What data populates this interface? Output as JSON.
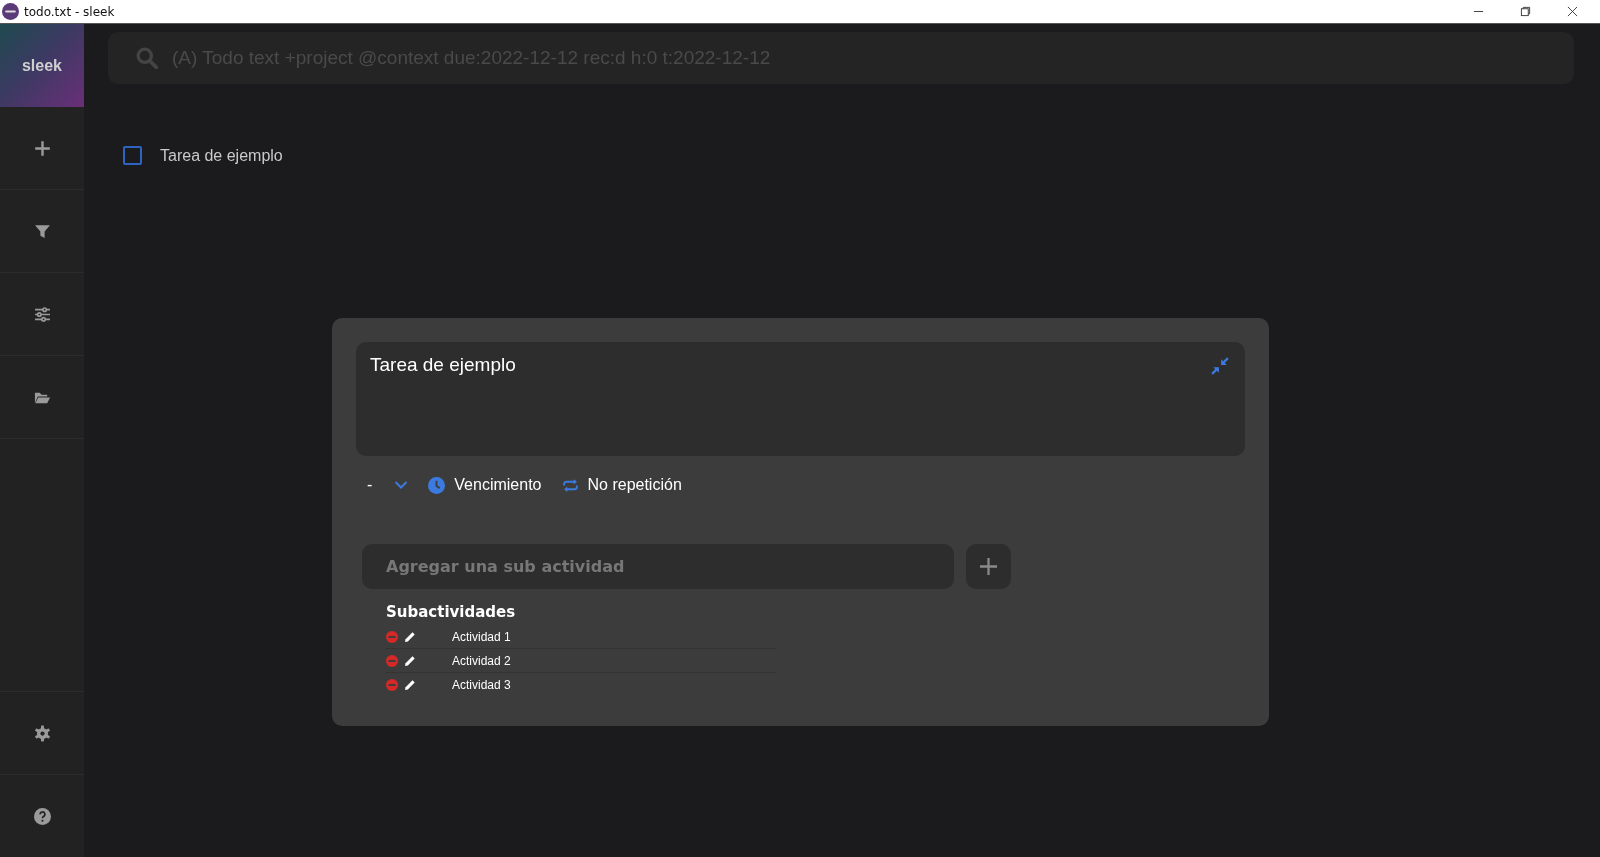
{
  "window": {
    "title": "todo.txt - sleek"
  },
  "sidebar": {
    "logo": "sleek"
  },
  "search": {
    "placeholder": "(A) Todo text +project @context due:2022-12-12 rec:d h:0 t:2022-12-12"
  },
  "todos": [
    {
      "text": "Tarea de ejemplo",
      "checked": false
    }
  ],
  "editor": {
    "value": "Tarea de ejemplo",
    "priority": "-",
    "due": "Vencimiento",
    "recurrence": "No repetición",
    "subtask_input": {
      "placeholder": "Agregar una sub actividad"
    },
    "subtasks_heading": "Subactividades",
    "subtasks": [
      {
        "text": "Actividad 1"
      },
      {
        "text": "Actividad 2"
      },
      {
        "text": "Actividad 3"
      }
    ]
  }
}
